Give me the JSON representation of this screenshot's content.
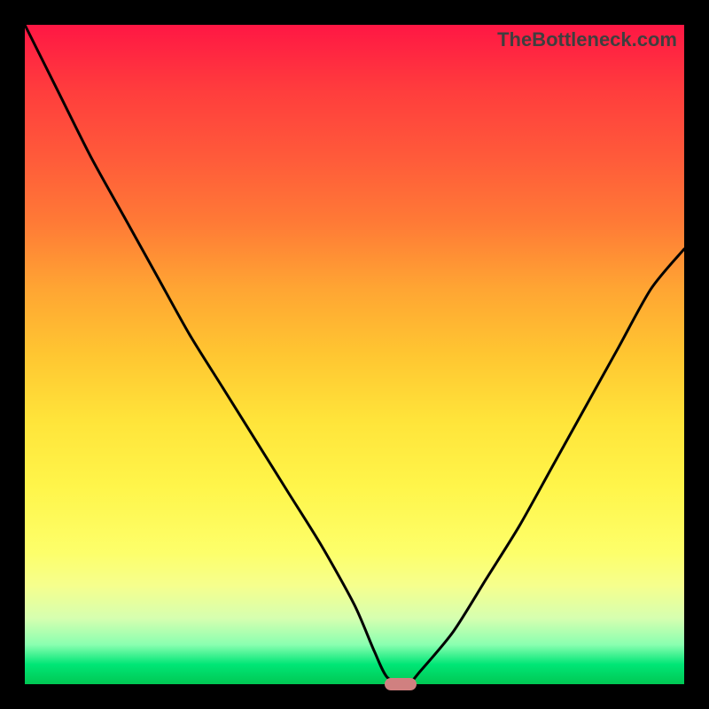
{
  "attribution": "TheBottleneck.com",
  "colors": {
    "frame": "#000000",
    "curve": "#000000",
    "marker": "#d08080",
    "gradient_stops": [
      [
        "#ff1744",
        0
      ],
      [
        "#ff3d3d",
        10
      ],
      [
        "#ff5a3a",
        20
      ],
      [
        "#ff7a36",
        30
      ],
      [
        "#ffa533",
        40
      ],
      [
        "#ffc631",
        50
      ],
      [
        "#ffe43a",
        60
      ],
      [
        "#fff54a",
        70
      ],
      [
        "#fdff6a",
        80
      ],
      [
        "#f6ff8d",
        85
      ],
      [
        "#d6ffb0",
        90
      ],
      [
        "#8affb0",
        94
      ],
      [
        "#00e676",
        97
      ],
      [
        "#00c853",
        100
      ]
    ]
  },
  "chart_data": {
    "type": "line",
    "title": "",
    "xlabel": "",
    "ylabel": "",
    "xlim": [
      0,
      100
    ],
    "ylim": [
      0,
      100
    ],
    "x": [
      0,
      5,
      10,
      15,
      20,
      25,
      30,
      35,
      40,
      45,
      50,
      53,
      55,
      58,
      60,
      65,
      70,
      75,
      80,
      85,
      90,
      95,
      100
    ],
    "values": [
      100,
      90,
      80,
      71,
      62,
      53,
      45,
      37,
      29,
      21,
      12,
      5,
      1,
      0,
      2,
      8,
      16,
      24,
      33,
      42,
      51,
      60,
      66
    ],
    "marker": {
      "x": 57,
      "y": 0,
      "width": 4.8,
      "height": 2
    }
  }
}
